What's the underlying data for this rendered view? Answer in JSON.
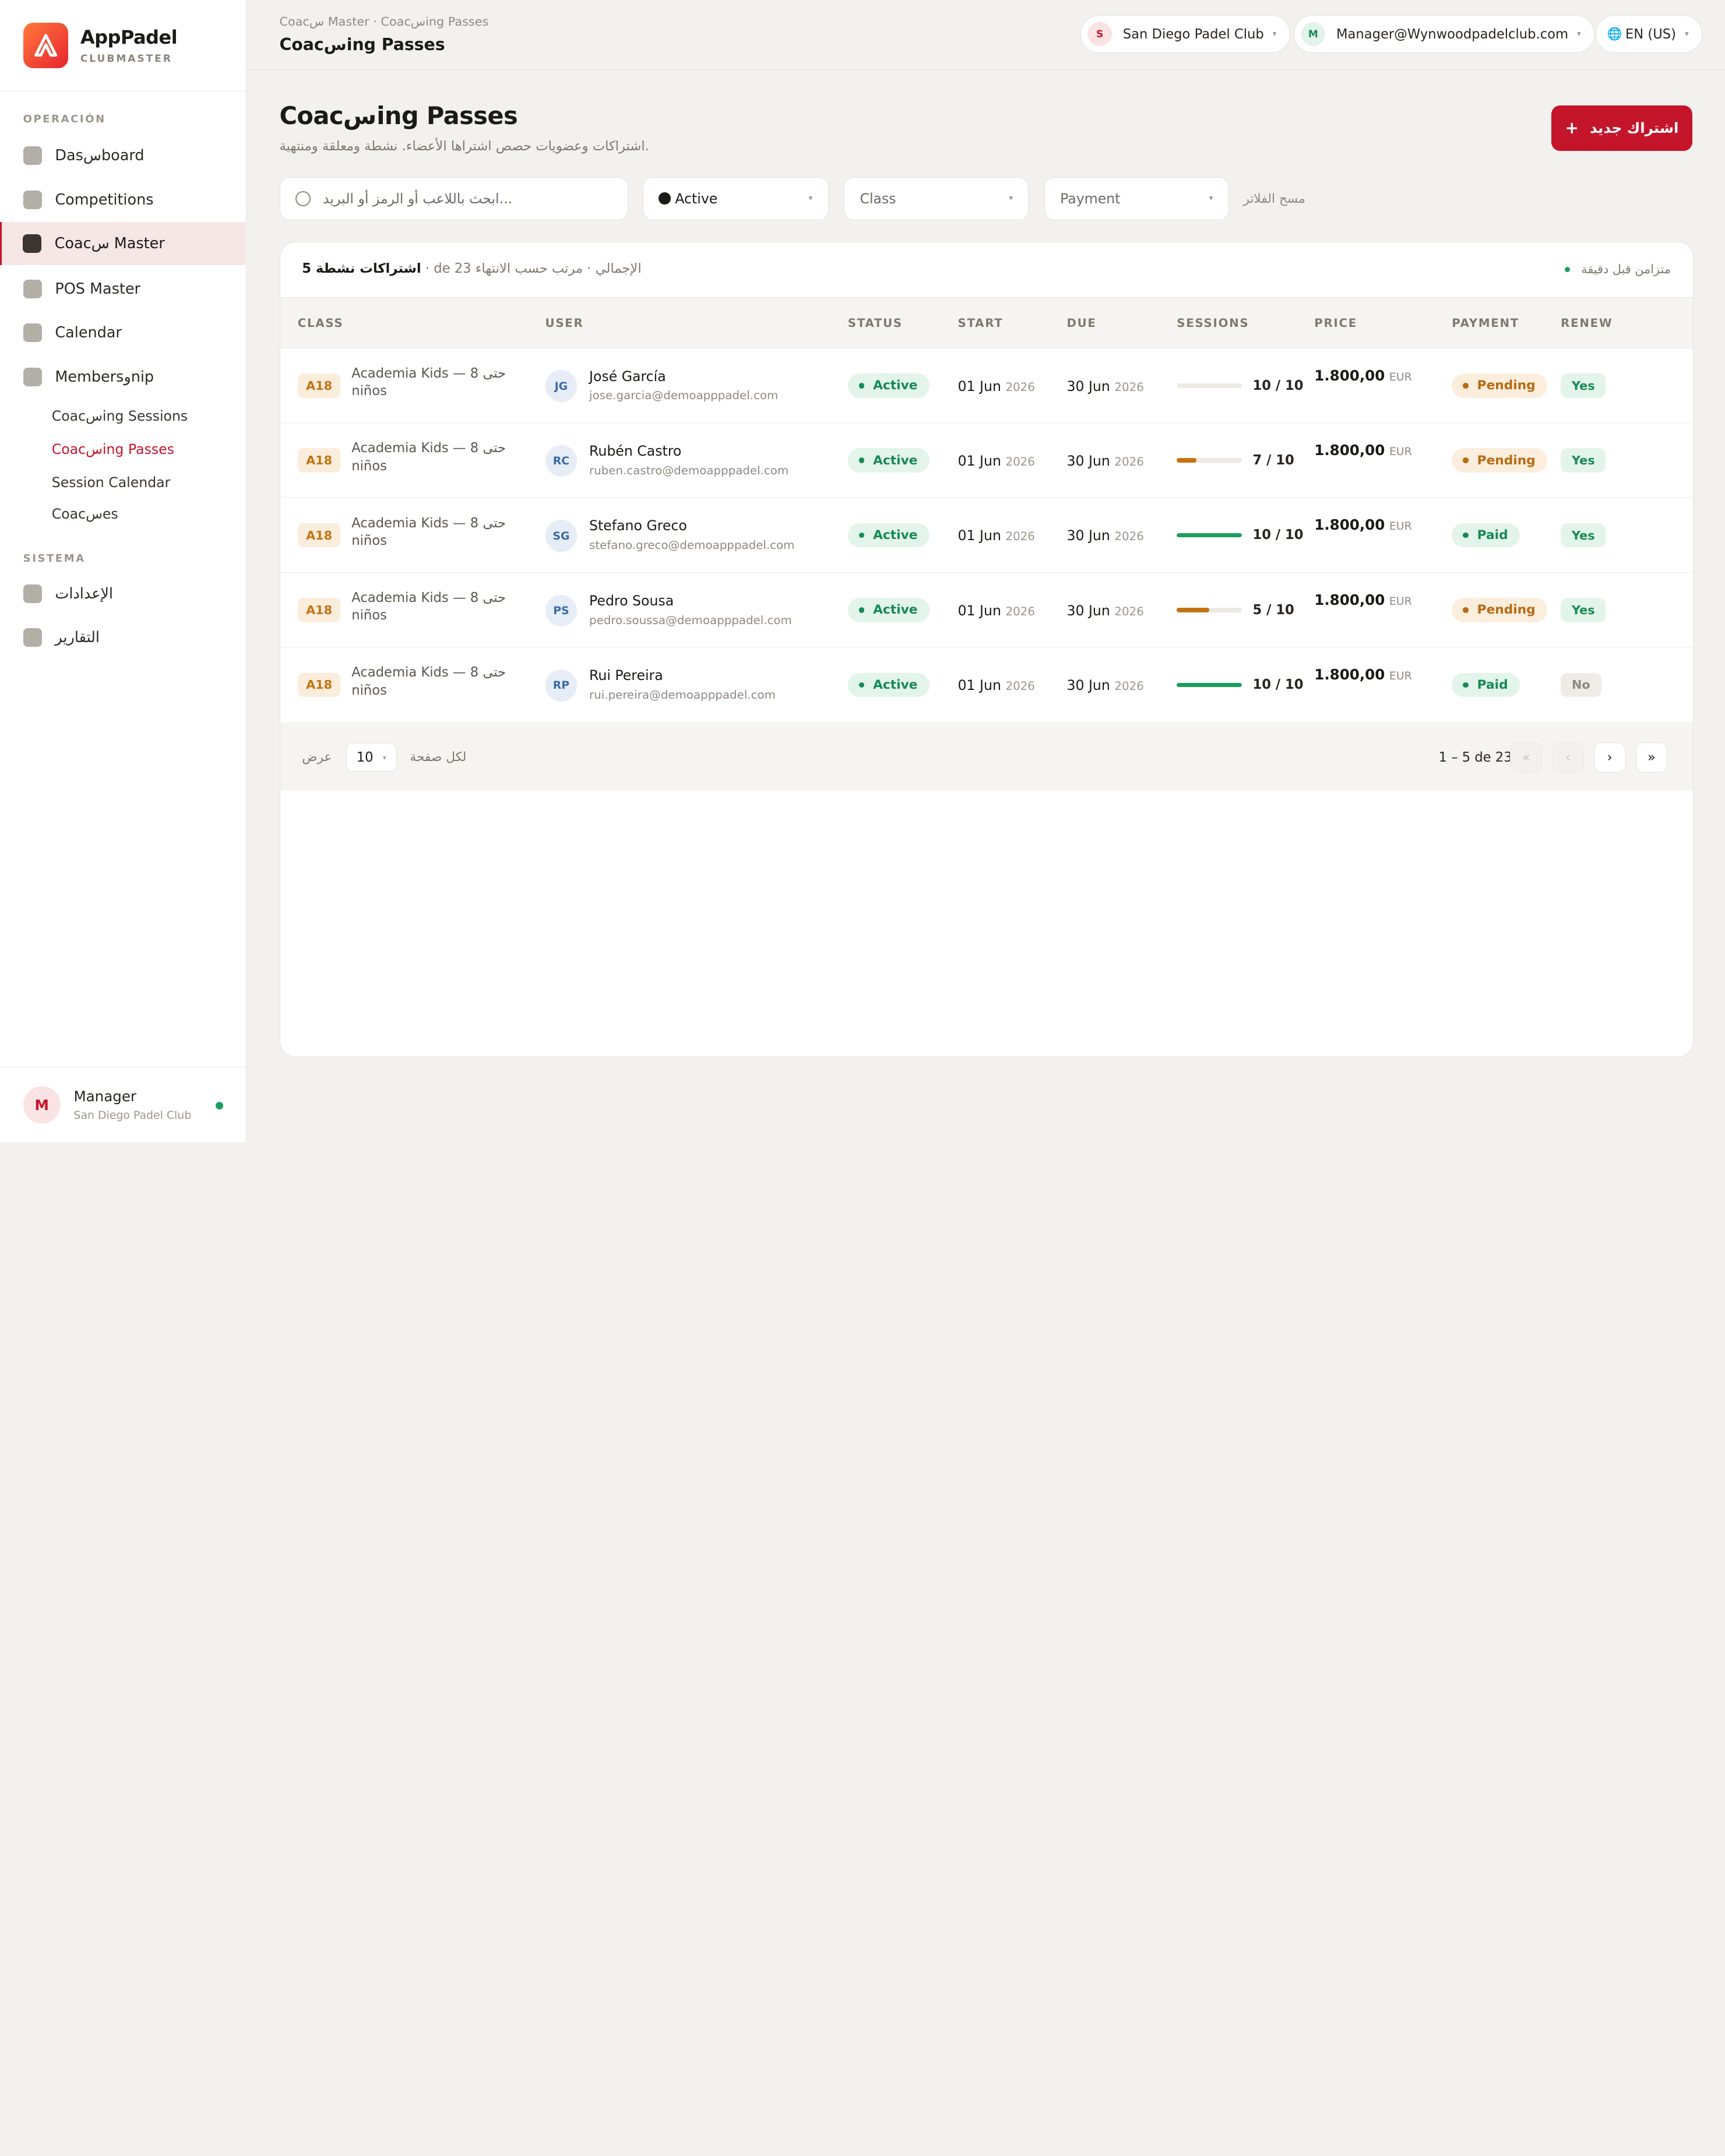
{
  "brand": {
    "name": "AppPadel",
    "sub": "CLUBMASTER"
  },
  "sidebar": {
    "sections": [
      "OPERACIÓN",
      "SISTEMA"
    ],
    "items": [
      {
        "label": "Dasسboard",
        "icon": "dashboard-icon"
      },
      {
        "label": "Competitions",
        "icon": "competitions-icon"
      },
      {
        "label": "Coacس Master",
        "icon": "coach-master-icon",
        "active": true
      },
      {
        "label": "POS Master",
        "icon": "pos-icon"
      },
      {
        "label": "Calendar",
        "icon": "calendar-icon"
      },
      {
        "label": "Membersوnip",
        "icon": "membership-icon"
      }
    ],
    "sub_items": [
      "Coacسing Sessions",
      "Coacسing Passes",
      "Session Calendar",
      "Coacسes"
    ],
    "system_items": [
      {
        "label": "الإعدادات",
        "icon": "settings-icon"
      },
      {
        "label": "التقارير",
        "icon": "reports-icon"
      }
    ],
    "footer": {
      "avatar": "M",
      "name": "Manager",
      "club": "San Diego Padel Club"
    }
  },
  "topbar": {
    "breadcrumb": "Coacس Master · Coacسing Passes",
    "title": "Coacسing Passes",
    "club": {
      "initial": "S",
      "label": "San Diego Padel Club"
    },
    "user": {
      "initial": "M",
      "label": "Manager@Wynwoodpadelclub.com"
    },
    "lang": {
      "icon": "🌐",
      "label": "EN (US)"
    }
  },
  "page": {
    "title": "Coacسing Passes",
    "subtitle": "اشتراكات وعضويات حصص اشتراها الأعضاء. نشطة ومعلقة ومنتهية.",
    "new_button": "اشتراك جديد",
    "new_button_icon": "+"
  },
  "filters": {
    "search_placeholder": "ابحث باللاعب أو الرمز أو البريد...",
    "status": "Active",
    "class": "Class",
    "payment": "Payment",
    "clear": "مسح الفلاتر"
  },
  "table": {
    "summary_count": "5 اشتراكات نشطة",
    "summary_rest": " · de 23 الإجمالي · مرتب حسب الانتهاء",
    "sync": "متزامن قبل دقيقة",
    "columns": [
      "CLASS",
      "USER",
      "STATUS",
      "START",
      "DUE",
      "SESSIONS",
      "PRICE",
      "PAYMENT",
      "RENEW"
    ],
    "rows": [
      {
        "code": "A18",
        "class": "Academia Kids — حتى 8 niños",
        "initials": "JG",
        "name": "José García",
        "email": "jose.garcia@demoapppadel.com",
        "status": "Active",
        "start": "01 Jun",
        "start_year": "2026",
        "due": "30 Jun",
        "due_year": "2026",
        "sessions": "10 / 10",
        "progress": 0,
        "price": "1.800,00",
        "currency": "EUR",
        "payment": "Pending",
        "renew": "Yes"
      },
      {
        "code": "A18",
        "class": "Academia Kids — حتى 8 niños",
        "initials": "RC",
        "name": "Rubén Castro",
        "email": "ruben.castro@demoapppadel.com",
        "status": "Active",
        "start": "01 Jun",
        "start_year": "2026",
        "due": "30 Jun",
        "due_year": "2026",
        "sessions": "7 / 10",
        "progress": 0.3,
        "price": "1.800,00",
        "currency": "EUR",
        "payment": "Pending",
        "renew": "Yes"
      },
      {
        "code": "A18",
        "class": "Academia Kids — حتى 8 niños",
        "initials": "SG",
        "name": "Stefano Greco",
        "email": "stefano.greco@demoapppadel.com",
        "status": "Active",
        "start": "01 Jun",
        "start_year": "2026",
        "due": "30 Jun",
        "due_year": "2026",
        "sessions": "10 / 10",
        "progress": 1,
        "price": "1.800,00",
        "currency": "EUR",
        "payment": "Paid",
        "renew": "Yes"
      },
      {
        "code": "A18",
        "class": "Academia Kids — حتى 8 niños",
        "initials": "PS",
        "name": "Pedro Sousa",
        "email": "pedro.soussa@demoapppadel.com",
        "status": "Active",
        "start": "01 Jun",
        "start_year": "2026",
        "due": "30 Jun",
        "due_year": "2026",
        "sessions": "5 / 10",
        "progress": 0.5,
        "price": "1.800,00",
        "currency": "EUR",
        "payment": "Pending",
        "renew": "Yes"
      },
      {
        "code": "A18",
        "class": "Academia Kids — حتى 8 niños",
        "initials": "RP",
        "name": "Rui Pereira",
        "email": "rui.pereira@demoapppadel.com",
        "status": "Active",
        "start": "01 Jun",
        "start_year": "2026",
        "due": "30 Jun",
        "due_year": "2026",
        "sessions": "10 / 10",
        "progress": 1,
        "price": "1.800,00",
        "currency": "EUR",
        "payment": "Paid",
        "renew": "No"
      }
    ],
    "footer": {
      "show": "عرض",
      "per_page": "10",
      "per_page_label": "لكل صفحة",
      "range": "1 – 5 de 23",
      "first": "«",
      "prev": "‹",
      "next": "›",
      "last": "»"
    }
  },
  "colors": {
    "accent": "#c4152b",
    "active_green": "#178a52",
    "progress_full": "#1a9e5c",
    "progress_partial": "#c27412",
    "pending_bg": "#fbeedd",
    "pending_fg": "#b86a10",
    "paid_bg": "#e3f4ea",
    "paid_fg": "#178a52",
    "renew_yes_bg": "#e3f4ea",
    "renew_yes_fg": "#178a52",
    "renew_no_bg": "#efece8",
    "renew_no_fg": "#8f8980"
  }
}
